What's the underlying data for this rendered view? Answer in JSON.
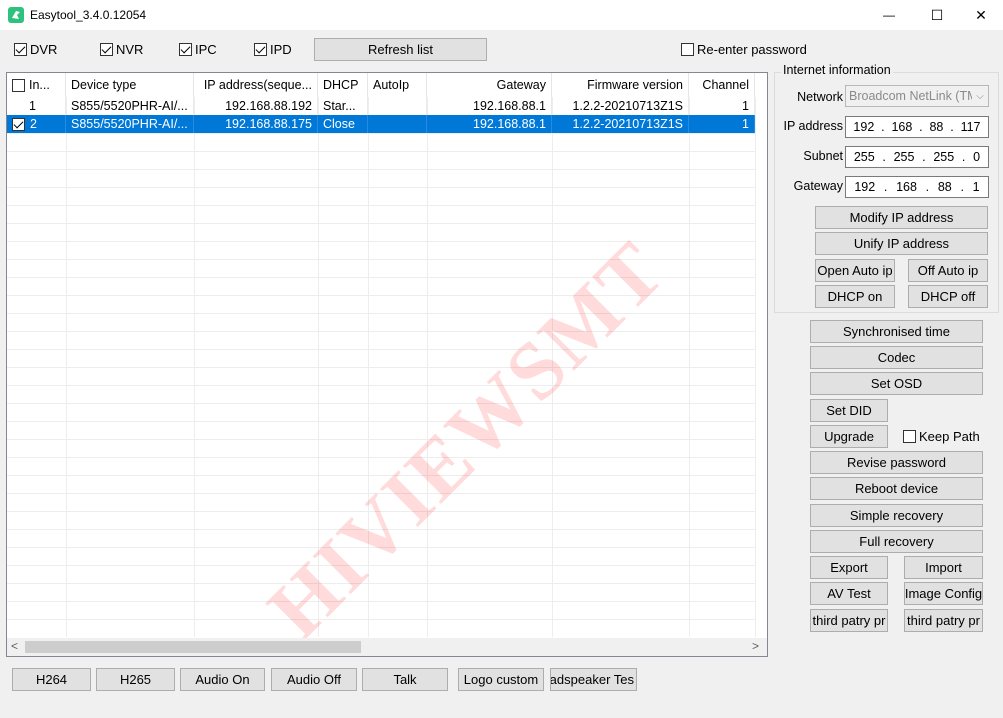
{
  "window": {
    "title": "Easytool_3.4.0.12054",
    "icon": "easytool-app-icon",
    "minimize_glyph": "—",
    "maximize_glyph": "☐",
    "close_glyph": "✕"
  },
  "toolbar": {
    "filters": [
      {
        "label": "DVR",
        "checked": true
      },
      {
        "label": "NVR",
        "checked": true
      },
      {
        "label": "IPC",
        "checked": true
      },
      {
        "label": "IPD",
        "checked": true
      }
    ],
    "refresh_label": "Refresh list",
    "reenter_password_label": "Re-enter password",
    "reenter_password_checked": false
  },
  "table": {
    "columns": [
      "In...",
      "Device type",
      "IP address(seque...",
      "DHCP",
      "AutoIp",
      "Gateway",
      "Firmware version",
      "Channel"
    ],
    "rows": [
      {
        "index": "1",
        "device_type": "S855/5520PHR-AI/...",
        "ip": "192.168.88.192",
        "dhcp": "Star...",
        "autoip": "",
        "gateway": "192.168.88.1",
        "firmware": "1.2.2-20210713Z1S",
        "channel": "1",
        "checked": false,
        "selected": false
      },
      {
        "index": "2",
        "device_type": "S855/5520PHR-AI/...",
        "ip": "192.168.88.175",
        "dhcp": "Close",
        "autoip": "",
        "gateway": "192.168.88.1",
        "firmware": "1.2.2-20210713Z1S",
        "channel": "1",
        "checked": true,
        "selected": true
      }
    ],
    "watermark": "HIVIEWSMT",
    "scroll_left_glyph": "<",
    "scroll_right_glyph": ">"
  },
  "internet": {
    "group_label": "Internet information",
    "network_label": "Network",
    "network_value": "Broadcom NetLink (TM",
    "ip_label": "IP address",
    "ip": [
      "192",
      "168",
      "88",
      "117"
    ],
    "subnet_label": "Subnet",
    "subnet": [
      "255",
      "255",
      "255",
      "0"
    ],
    "gateway_label": "Gateway",
    "gateway": [
      "192",
      "168",
      "88",
      "1"
    ],
    "modify_ip": "Modify IP address",
    "unify_ip": "Unify IP address",
    "open_auto_ip": "Open Auto ip",
    "off_auto_ip": "Off Auto ip",
    "dhcp_on": "DHCP on",
    "dhcp_off": "DHCP off"
  },
  "actions": {
    "sync_time": "Synchronised time",
    "codec": "Codec",
    "set_osd": "Set OSD",
    "set_did": "Set DID",
    "upgrade": "Upgrade",
    "keep_path": "Keep Path",
    "keep_path_checked": false,
    "revise_password": "Revise password",
    "reboot_device": "Reboot device",
    "simple_recovery": "Simple recovery",
    "full_recovery": "Full recovery",
    "export": "Export",
    "import": "Import",
    "av_test": "AV Test",
    "image_config": "Image Config",
    "third_party_1": "third patry pr",
    "third_party_2": "third patry pr"
  },
  "bottom": {
    "h264": "H264",
    "h265": "H265",
    "audio_on": "Audio On",
    "audio_off": "Audio Off",
    "talk": "Talk",
    "logo_custom": "Logo custom",
    "loudspeaker_test": "oadspeaker Tes"
  },
  "colors": {
    "selection": "#0078d7",
    "watermark": "#ff0000",
    "app_icon": "#2ec27e"
  }
}
